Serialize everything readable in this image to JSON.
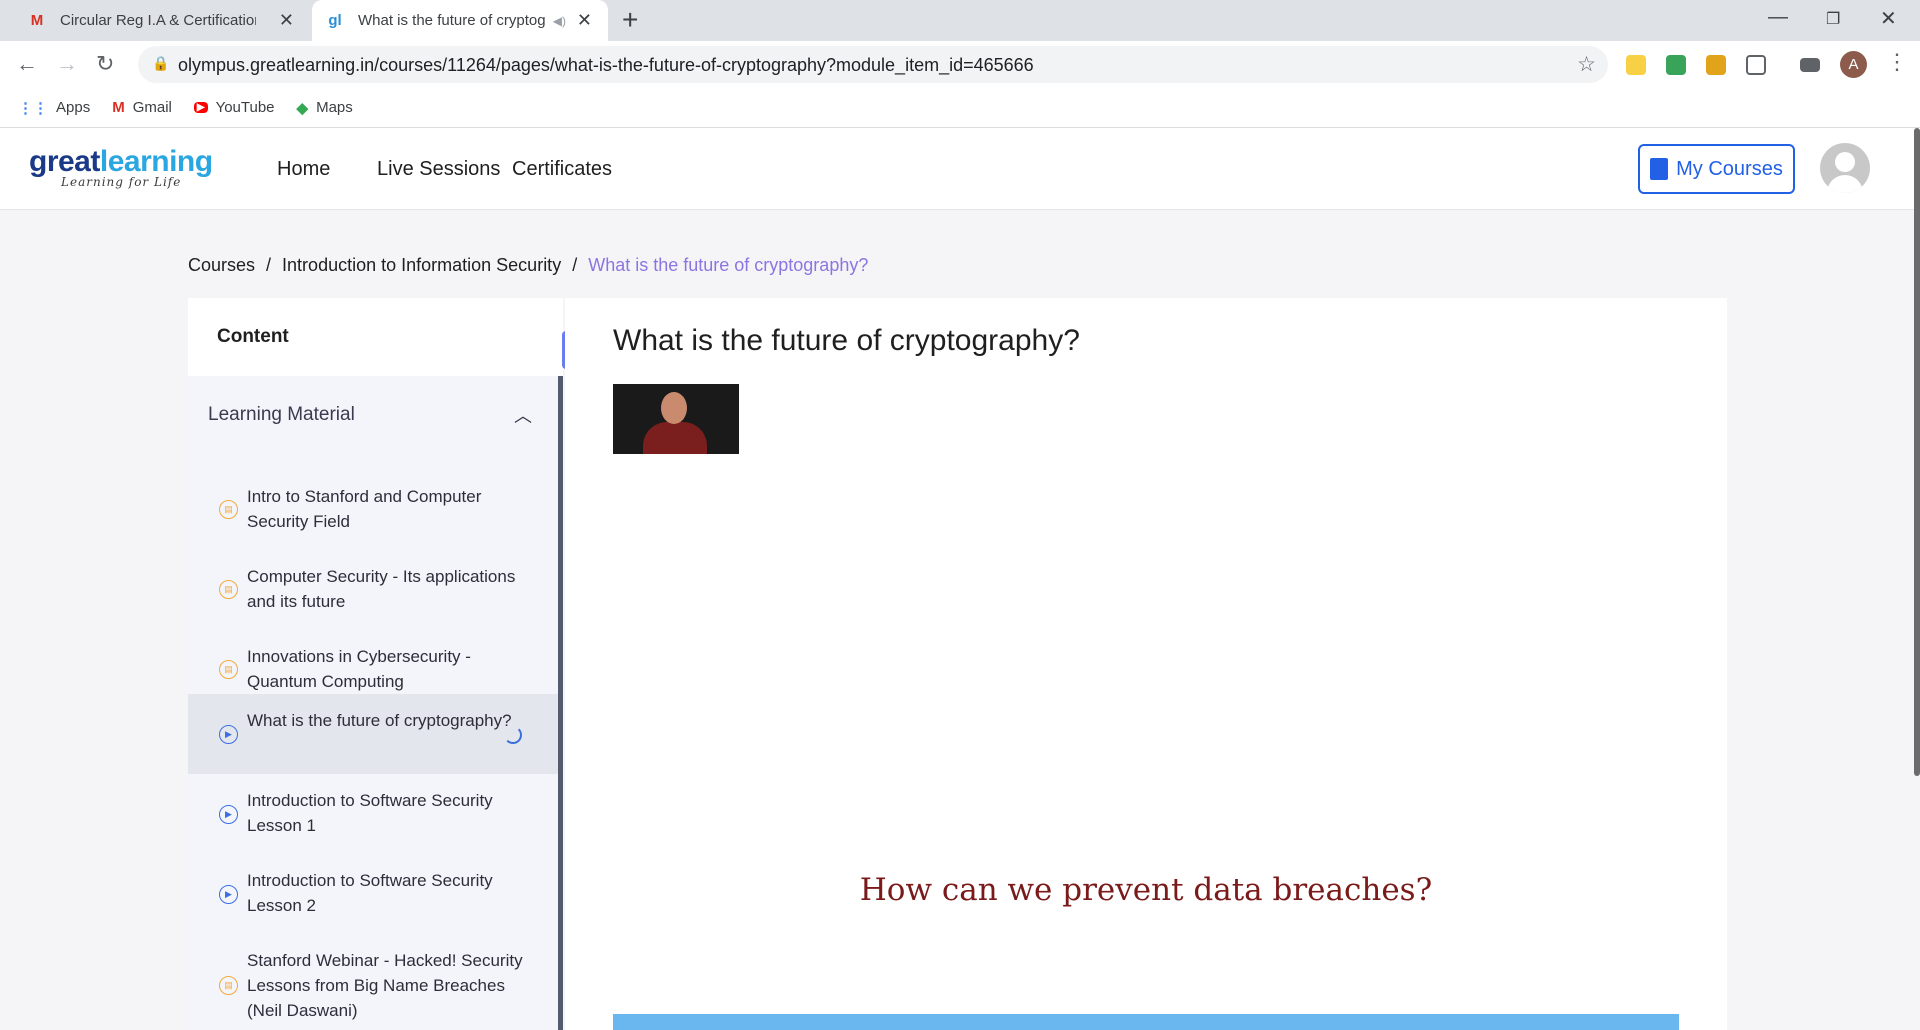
{
  "browser": {
    "tabs": [
      {
        "title": "Circular Reg I.A & Certifications/",
        "favicon": "gmail-icon"
      },
      {
        "title": "What is the future of cryptog",
        "favicon": "greatlearning-icon"
      }
    ],
    "new_tab": "+",
    "url": "olympus.greatlearning.in/courses/11264/pages/what-is-the-future-of-cryptography?module_item_id=465666",
    "profile_initial": "A",
    "bookmarks": [
      {
        "label": "Apps",
        "icon": "apps-grid-icon"
      },
      {
        "label": "Gmail",
        "icon": "gmail-icon"
      },
      {
        "label": "YouTube",
        "icon": "youtube-icon"
      },
      {
        "label": "Maps",
        "icon": "maps-icon"
      }
    ]
  },
  "site": {
    "logo_word_a": "great",
    "logo_word_b": "learning",
    "logo_tagline": "Learning for Life",
    "nav": [
      "Home",
      "Live Sessions",
      "Certificates"
    ],
    "my_courses": "My Courses"
  },
  "breadcrumb": [
    "Courses",
    "Introduction to Information Security",
    "What is the future of cryptography?"
  ],
  "sidebar": {
    "content_label": "Content",
    "section_title": "Learning Material",
    "items": [
      {
        "label": "Intro to Stanford and Computer Security Field",
        "type": "document"
      },
      {
        "label": "Computer Security - Its applications and its future",
        "type": "document"
      },
      {
        "label": "Innovations in Cybersecurity - Quantum Computing",
        "type": "document"
      },
      {
        "label": "What is the future of cryptography?",
        "type": "video",
        "active": true
      },
      {
        "label": "Introduction to Software Security Lesson 1",
        "type": "video"
      },
      {
        "label": "Introduction to Software Security Lesson 2",
        "type": "video"
      },
      {
        "label": "Stanford Webinar - Hacked! Security Lessons from Big Name Breaches (Neil Daswani)",
        "type": "document"
      }
    ]
  },
  "main": {
    "title": "What is the future of cryptography?",
    "video_caption": "How can we prevent data breaches?"
  },
  "colors": {
    "accent": "#2261e6",
    "breadcrumb_current": "#8c75e0",
    "caption": "#7a1a1a",
    "video_bar": "#6ab7f0"
  }
}
